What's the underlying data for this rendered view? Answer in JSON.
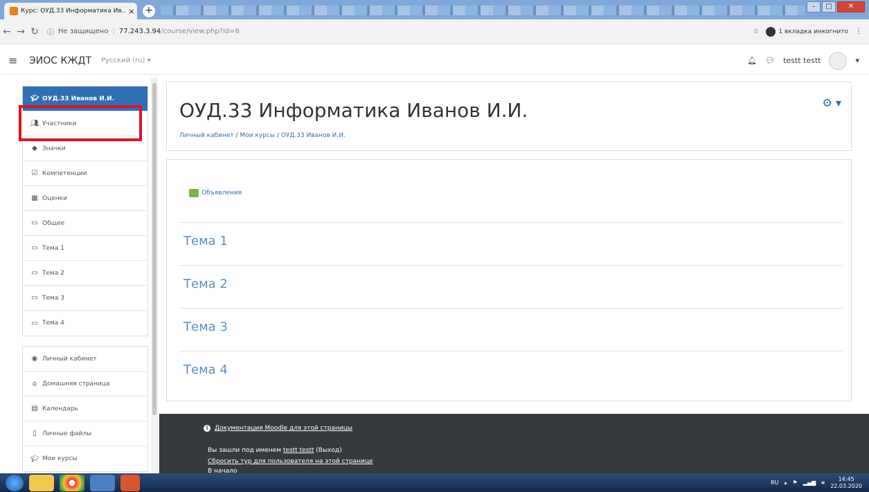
{
  "browser": {
    "tab_title": "Курс: ОУД.33 Информатика Ив...",
    "tab_close": "×",
    "new_tab": "+",
    "not_secure": "Не защищено",
    "url_host": "77.243.3.94",
    "url_path": "/course/view.php?id=6",
    "incognito": "1 вкладка инкогнито"
  },
  "app": {
    "site_name": "ЭИОС КЖДТ",
    "language": "Русский (ru) ▾",
    "user_name": "testt testt"
  },
  "sidebar": {
    "course_item": "ОУД.33 Иванов И.И.",
    "course_items": [
      {
        "label": "Участники",
        "icon": "users-icon"
      },
      {
        "label": "Значки",
        "icon": "badge-icon"
      },
      {
        "label": "Компетенции",
        "icon": "competency-icon"
      },
      {
        "label": "Оценки",
        "icon": "grades-icon"
      },
      {
        "label": "Общее",
        "icon": "folder-icon"
      },
      {
        "label": "Тема 1",
        "icon": "folder-icon"
      },
      {
        "label": "Тема 2",
        "icon": "folder-icon"
      },
      {
        "label": "Тема 3",
        "icon": "folder-icon"
      },
      {
        "label": "Тема 4",
        "icon": "folder-icon"
      }
    ],
    "site_items": [
      {
        "label": "Личный кабинет",
        "icon": "dashboard-icon"
      },
      {
        "label": "Домашняя страница",
        "icon": "home-icon"
      },
      {
        "label": "Календарь",
        "icon": "calendar-icon"
      },
      {
        "label": "Личные файлы",
        "icon": "file-icon"
      },
      {
        "label": "Мои курсы",
        "icon": "graduation-cap-icon"
      }
    ]
  },
  "header": {
    "title": "ОУД.33 Информатика Иванов И.И.",
    "breadcrumb": [
      "Личный кабинет",
      "Мои курсы",
      "ОУД.33 Иванов И.И."
    ]
  },
  "content": {
    "news": "Объявления",
    "sections": [
      "Тема 1",
      "Тема 2",
      "Тема 3",
      "Тема 4"
    ]
  },
  "footer": {
    "doc_link": "Документация Moodle для этой страницы",
    "logged_in_prefix": "Вы зашли под именем",
    "logged_in_user": "testt testt",
    "logout": "(Выход)",
    "reset_tour": "Сбросить тур для пользователя на этой странице",
    "home": "В начало"
  },
  "taskbar": {
    "lang": "RU",
    "time": "14:45",
    "date": "22.03.2020"
  },
  "colors": {
    "accent": "#2f6fb3",
    "highlight": "#e0141e",
    "footer": "#373a3c"
  }
}
